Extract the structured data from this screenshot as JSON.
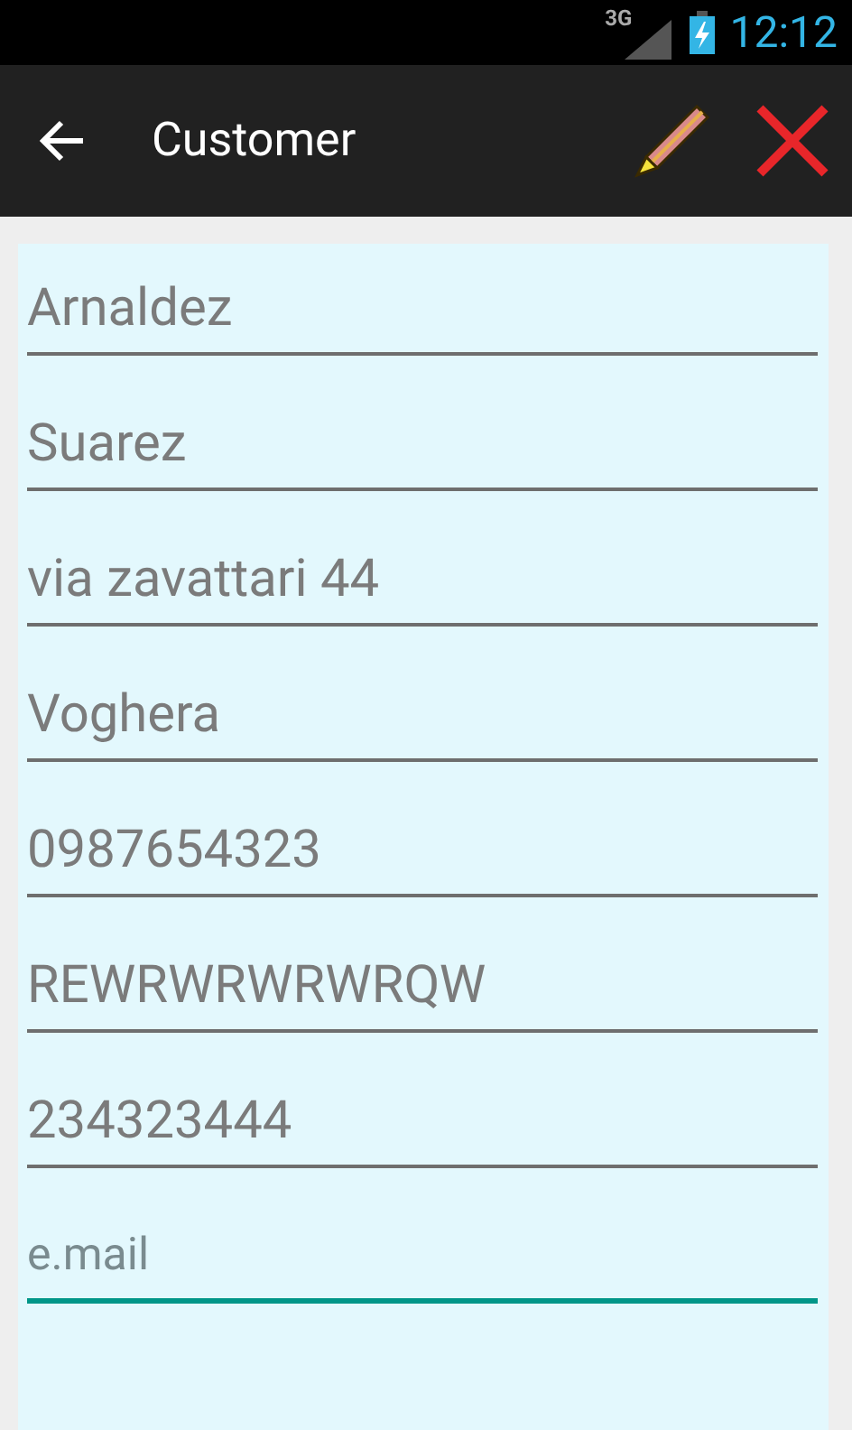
{
  "status_bar": {
    "network": "3G",
    "time": "12:12"
  },
  "toolbar": {
    "title": "Customer"
  },
  "fields": [
    {
      "value": "Arnaldez",
      "focused": false
    },
    {
      "value": "Suarez",
      "focused": false
    },
    {
      "value": "via zavattari 44",
      "focused": false
    },
    {
      "value": "Voghera",
      "focused": false
    },
    {
      "value": "0987654323",
      "focused": false
    },
    {
      "value": "REWRWRWRWRQW",
      "focused": false
    },
    {
      "value": "234323444",
      "focused": false
    },
    {
      "placeholder": "e.mail",
      "focused": true
    }
  ]
}
